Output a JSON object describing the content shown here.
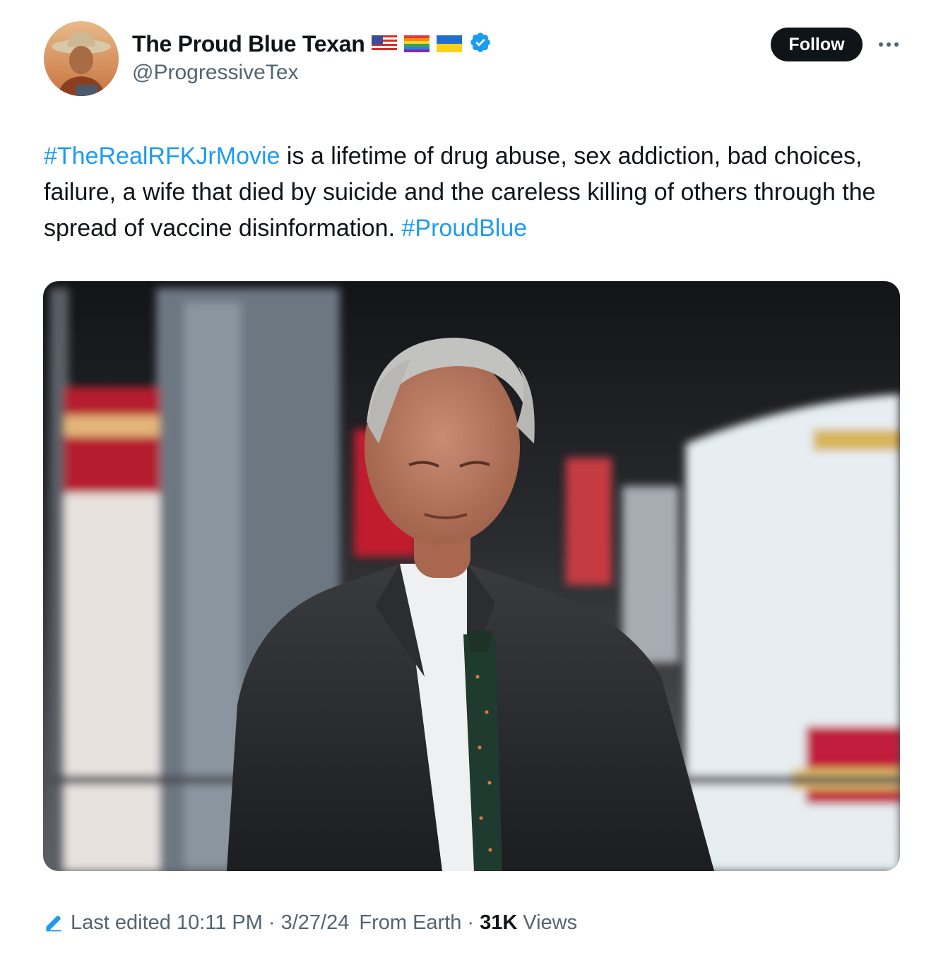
{
  "tweet": {
    "author": {
      "display_name": "The Proud Blue Texan",
      "handle": "@ProgressiveTex",
      "badges": [
        "us-flag-icon",
        "rainbow-flag-icon",
        "ukraine-flag-icon",
        "verified-badge-icon"
      ]
    },
    "follow_label": "Follow",
    "more_icon": "more-options-icon",
    "text": {
      "hashtag_1": "#TheRealRFKJrMovie",
      "body": " is a lifetime of drug abuse, sex addiction, bad choices, failure, a wife that died by suicide and the careless killing of others through the spread of vaccine disinformation. ",
      "hashtag_2": "#ProudBlue"
    },
    "meta": {
      "edited_icon": "pencil-icon",
      "last_edited": "Last edited 10:11 PM",
      "separator": "·",
      "date": "3/27/24",
      "source": "From Earth",
      "views_count": "31K",
      "views_label": "Views"
    }
  },
  "colors": {
    "text": "#0f1419",
    "secondary": "#536471",
    "accent": "#1d9bf0",
    "follow_bg": "#0f1419"
  }
}
